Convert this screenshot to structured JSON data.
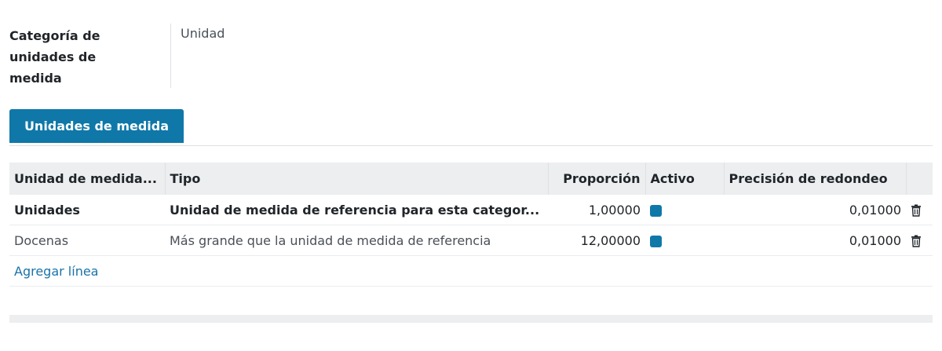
{
  "field": {
    "label": "Categoría de unidades de medida",
    "value": "Unidad"
  },
  "tabs": [
    {
      "label": "Unidades de medida",
      "active": true
    }
  ],
  "table": {
    "headers": [
      "Unidad de medida...",
      "Tipo",
      "Proporción",
      "Activo",
      "Precisión de redondeo"
    ],
    "rows": [
      {
        "unit": "Unidades",
        "type": "Unidad de medida de referencia para esta categor...",
        "ratio": "1,00000",
        "active": true,
        "rounding": "0,01000"
      },
      {
        "unit": "Docenas",
        "type": "Más grande que la unidad de medida de referencia",
        "ratio": "12,00000",
        "active": true,
        "rounding": "0,01000"
      }
    ],
    "add_line": "Agregar línea"
  },
  "colors": {
    "accent": "#0f78a8",
    "header_bg": "#eceeef"
  },
  "icons": {
    "delete": "trash-icon",
    "checkbox": "checkbox-checked-icon"
  }
}
